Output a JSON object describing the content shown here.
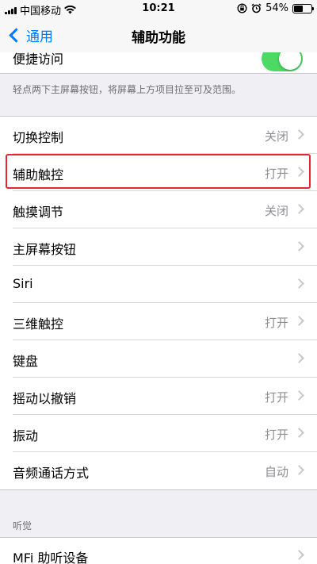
{
  "status_bar": {
    "carrier": "中国移动",
    "time": "10:21",
    "battery_percent": "54%",
    "battery_level": 0.54
  },
  "nav": {
    "back_label": "通用",
    "title": "辅助功能"
  },
  "top_row": {
    "label": "便捷访问",
    "toggle_on": true
  },
  "footnote": "轻点两下主屏幕按钮，将屏幕上方项目拉至可及范围。",
  "settings": [
    {
      "label": "切换控制",
      "value": "关闭"
    },
    {
      "label": "辅助触控",
      "value": "打开",
      "highlighted": true
    },
    {
      "label": "触摸调节",
      "value": "关闭"
    },
    {
      "label": "主屏幕按钮",
      "value": ""
    },
    {
      "label": "Siri",
      "value": ""
    },
    {
      "label": "三维触控",
      "value": "打开"
    },
    {
      "label": "键盘",
      "value": ""
    },
    {
      "label": "摇动以撤销",
      "value": "打开"
    },
    {
      "label": "振动",
      "value": "打开"
    },
    {
      "label": "音频通话方式",
      "value": "自动"
    }
  ],
  "hearing": {
    "header": "听觉",
    "items": [
      {
        "label": "MFi 助听设备",
        "value": ""
      }
    ]
  },
  "colors": {
    "accent": "#007aff",
    "toggle_on": "#4cd964",
    "highlight_border": "#e8262c"
  }
}
